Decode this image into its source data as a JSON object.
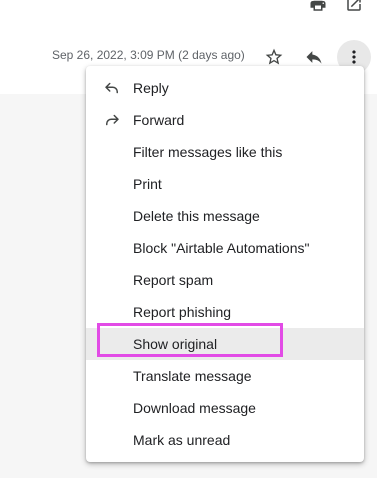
{
  "header": {
    "timestamp": "Sep 26, 2022, 3:09 PM (2 days ago)"
  },
  "top_icons": [
    "print-icon",
    "open-in-new-window-icon"
  ],
  "header_icons": [
    "star-icon",
    "reply-icon",
    "more-vert-icon"
  ],
  "menu": {
    "items": [
      {
        "label": "Reply",
        "icon": "reply-icon"
      },
      {
        "label": "Forward",
        "icon": "forward-icon"
      },
      {
        "label": "Filter messages like this"
      },
      {
        "label": "Print"
      },
      {
        "label": "Delete this message"
      },
      {
        "label": "Block \"Airtable Automations\""
      },
      {
        "label": "Report spam"
      },
      {
        "label": "Report phishing"
      },
      {
        "label": "Show original",
        "highlighted": true
      },
      {
        "label": "Translate message"
      },
      {
        "label": "Download message"
      },
      {
        "label": "Mark as unread"
      }
    ]
  },
  "colors": {
    "highlight_border": "#e24be6",
    "hover_background": "#ebebeb",
    "icon": "#444746"
  }
}
